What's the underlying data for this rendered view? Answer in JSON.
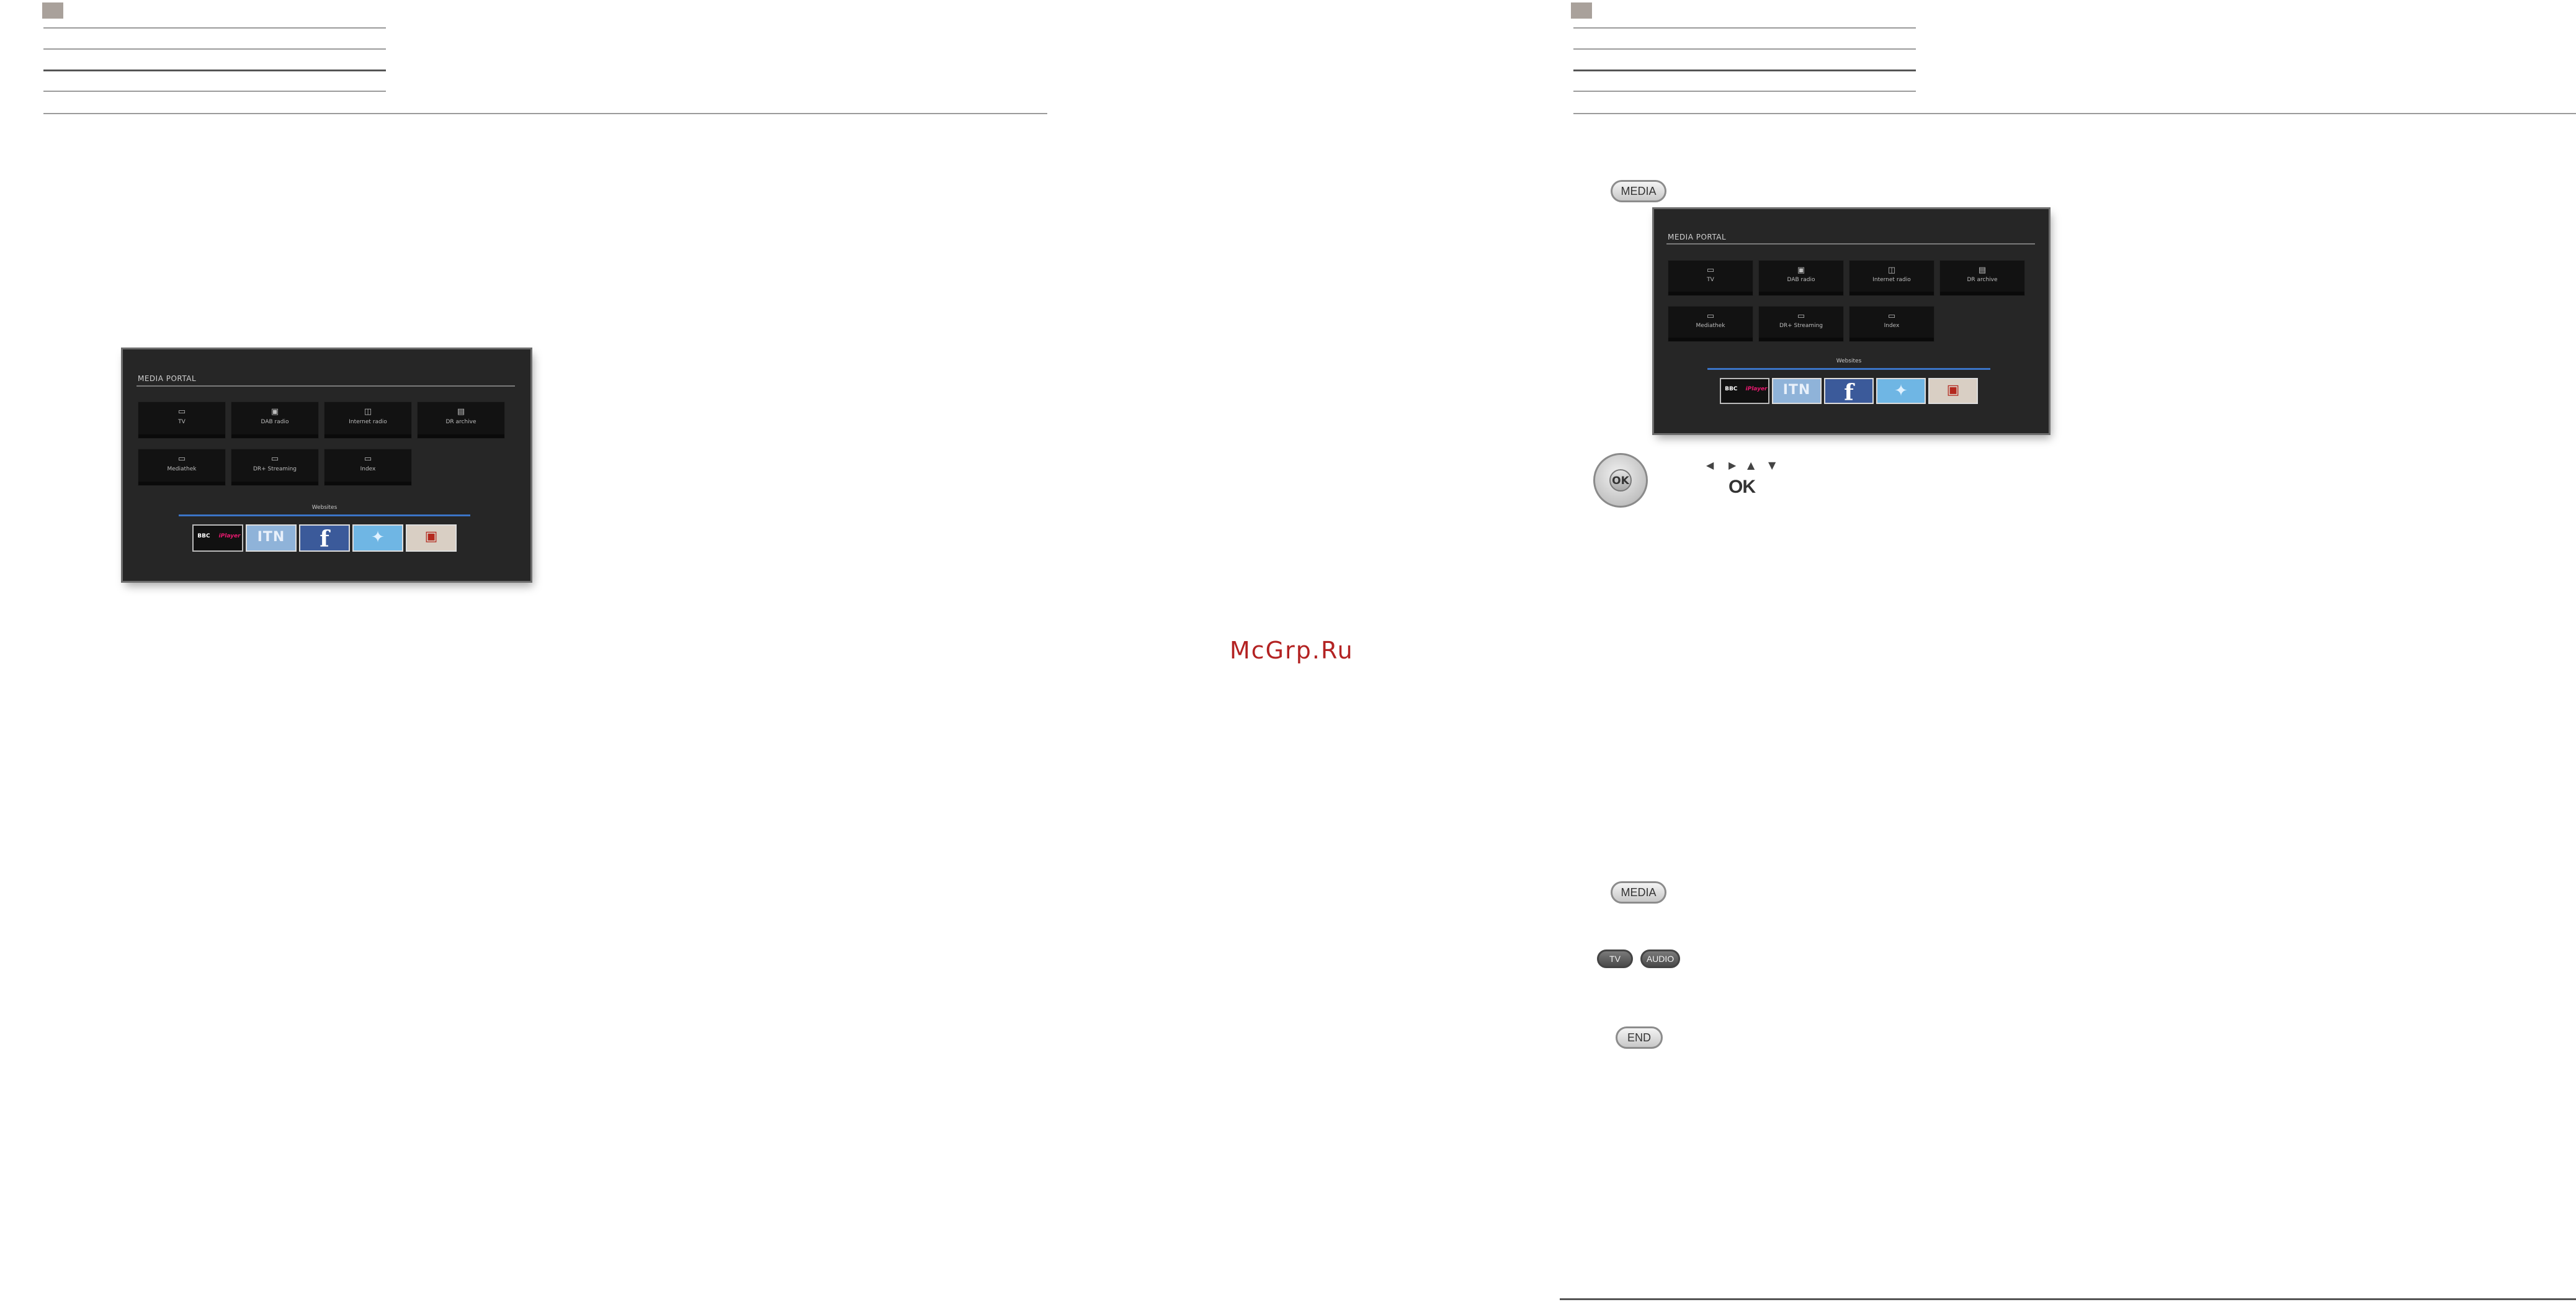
{
  "media_portal": {
    "title": "MEDIA PORTAL",
    "tiles": [
      {
        "icon": "tv-icon",
        "glyph": "▭",
        "label": "TV"
      },
      {
        "icon": "radio-icon",
        "glyph": "▣",
        "label": "DAB radio"
      },
      {
        "icon": "internet-radio-icon",
        "glyph": "◫",
        "label": "Internet radio"
      },
      {
        "icon": "archive-icon",
        "glyph": "▤",
        "label": "DR archive"
      },
      {
        "icon": "mediathek-icon",
        "glyph": "▭",
        "label": "Mediathek"
      },
      {
        "icon": "streaming-icon",
        "glyph": "▭",
        "label": "DR+ Streaming"
      },
      {
        "icon": "index-icon",
        "glyph": "▭",
        "label": "Index"
      }
    ],
    "websites_label": "Websites",
    "websites": [
      {
        "icon": "bbc-iplayer-logo",
        "text_a": "BBC",
        "text_b": "iPlayer"
      },
      {
        "icon": "itn-logo",
        "text": "ITN"
      },
      {
        "icon": "facebook-logo",
        "text": "f"
      },
      {
        "icon": "twitter-logo",
        "text": "✦"
      },
      {
        "icon": "picture-logo",
        "text": "▣"
      }
    ]
  },
  "remote": {
    "media_button": "MEDIA",
    "ok_label": "OK",
    "arrow_left": "◀",
    "arrow_right": "▶",
    "arrow_up": "▲",
    "arrow_down": "▼",
    "ok_mark": "OK",
    "tv_button": "TV",
    "audio_button": "AUDIO",
    "end_button": "END"
  },
  "watermark": "McGrp.Ru"
}
